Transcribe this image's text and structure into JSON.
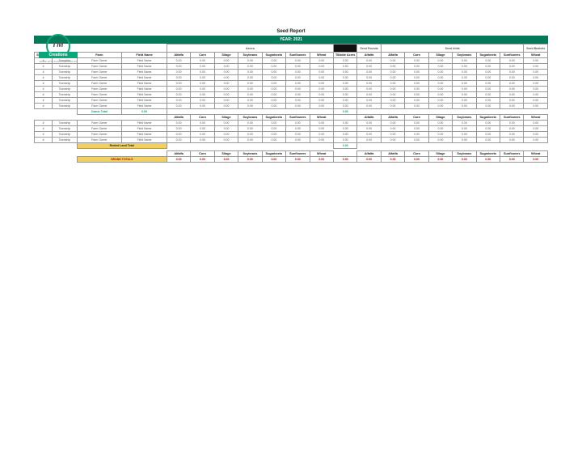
{
  "logo": {
    "initials": "TM",
    "banner": "Creations",
    "sub": "WORK WITH PURPOSE & TRUST"
  },
  "report_title": "Seed Report",
  "year_label": "YEAR: 2021",
  "group_headers": {
    "acres": "Acres",
    "seed_pounds": "Seed Pounds",
    "seed_units": "Seed Units",
    "seed_bushels": "Seed Bushels"
  },
  "columns": {
    "section": "Section #",
    "township": "Township",
    "farm": "Farm",
    "field": "Field Name",
    "crops": [
      "Alfalfa",
      "Corn",
      "Silage",
      "Soybeans",
      "Sugarbeets",
      "Sunflowers",
      "Wheat"
    ],
    "tillable": "Tillable Acres",
    "su_crops": [
      "Alfalfa",
      "Corn",
      "Silage",
      "Soybeans",
      "Sugarbeets",
      "Sunflowers"
    ],
    "wheat": "Wheat"
  },
  "section1_rows": [
    {
      "sec": "#",
      "twp": "Township",
      "farm": "Farm Owner",
      "field": "Field Name",
      "acres": [
        "0.00",
        "0.00",
        "0.00",
        "0.00",
        "0.00",
        "0.00",
        "0.00"
      ],
      "tillable": "0.00",
      "pounds": "0.00",
      "units": [
        "0.00",
        "0.00",
        "0.00",
        "0.00",
        "0.00",
        "0.00"
      ],
      "bushels": "0.00"
    },
    {
      "sec": "#",
      "twp": "Township",
      "farm": "Farm Owner",
      "field": "Field Name",
      "acres": [
        "0.00",
        "0.00",
        "0.00",
        "0.00",
        "0.00",
        "0.00",
        "0.00"
      ],
      "tillable": "0.00",
      "pounds": "0.00",
      "units": [
        "0.00",
        "0.00",
        "0.00",
        "0.00",
        "0.00",
        "0.00"
      ],
      "bushels": "0.00"
    },
    {
      "sec": "#",
      "twp": "Township",
      "farm": "Farm Owner",
      "field": "Field Name",
      "acres": [
        "0.00",
        "0.00",
        "0.00",
        "0.00",
        "0.00",
        "0.00",
        "0.00"
      ],
      "tillable": "0.00",
      "pounds": "0.00",
      "units": [
        "0.00",
        "0.00",
        "0.00",
        "0.00",
        "0.00",
        "0.00"
      ],
      "bushels": "0.00"
    },
    {
      "sec": "#",
      "twp": "Township",
      "farm": "Farm Owner",
      "field": "Field Name",
      "acres": [
        "0.00",
        "0.00",
        "0.00",
        "0.00",
        "0.00",
        "0.00",
        "0.00"
      ],
      "tillable": "0.00",
      "pounds": "0.00",
      "units": [
        "0.00",
        "0.00",
        "0.00",
        "0.00",
        "0.00",
        "0.00"
      ],
      "bushels": "0.00"
    },
    {
      "sec": "#",
      "twp": "Township",
      "farm": "Farm Owner",
      "field": "Field Name",
      "acres": [
        "0.00",
        "0.00",
        "0.00",
        "0.00",
        "0.00",
        "0.00",
        "0.00"
      ],
      "tillable": "0.00",
      "pounds": "0.00",
      "units": [
        "0.00",
        "0.00",
        "0.00",
        "0.00",
        "0.00",
        "0.00"
      ],
      "bushels": "0.00"
    },
    {
      "sec": "#",
      "twp": "Township",
      "farm": "Farm Owner",
      "field": "Field Name",
      "acres": [
        "0.00",
        "0.00",
        "0.00",
        "0.00",
        "0.00",
        "0.00",
        "0.00"
      ],
      "tillable": "0.00",
      "pounds": "0.00",
      "units": [
        "0.00",
        "0.00",
        "0.00",
        "0.00",
        "0.00",
        "0.00"
      ],
      "bushels": "0.00"
    },
    {
      "sec": "#",
      "twp": "Township",
      "farm": "Farm Owner",
      "field": "Field Name",
      "acres": [
        "0.00",
        "0.00",
        "0.00",
        "0.00",
        "0.00",
        "0.00",
        "0.00"
      ],
      "tillable": "0.00",
      "pounds": "0.00",
      "units": [
        "0.00",
        "0.00",
        "0.00",
        "0.00",
        "0.00",
        "0.00"
      ],
      "bushels": "0.00"
    },
    {
      "sec": "#",
      "twp": "Township",
      "farm": "Farm Owner",
      "field": "Field Name",
      "acres": [
        "0.00",
        "0.00",
        "0.00",
        "0.00",
        "0.00",
        "0.00",
        "0.00"
      ],
      "tillable": "0.00",
      "pounds": "0.00",
      "units": [
        "0.00",
        "0.00",
        "0.00",
        "0.00",
        "0.00",
        "0.00"
      ],
      "bushels": "0.00"
    },
    {
      "sec": "#",
      "twp": "Township",
      "farm": "Farm Owner",
      "field": "Field Name",
      "acres": [
        "0.00",
        "0.00",
        "0.00",
        "0.00",
        "0.00",
        "0.00",
        "0.00"
      ],
      "tillable": "0.00",
      "pounds": "0.00",
      "units": [
        "0.00",
        "0.00",
        "0.00",
        "0.00",
        "0.00",
        "0.00"
      ],
      "bushels": "0.00"
    }
  ],
  "owner_total_label": "Owner Total",
  "owner_total_values": [
    "0.00",
    "0.00"
  ],
  "section2_rows": [
    {
      "sec": "#",
      "twp": "Township",
      "farm": "Farm Owner",
      "field": "Field Name",
      "acres": [
        "0.00",
        "0.00",
        "0.00",
        "0.00",
        "0.00",
        "0.00",
        "0.00"
      ],
      "tillable": "0.00",
      "pounds": "0.00",
      "units": [
        "0.00",
        "0.00",
        "0.00",
        "0.00",
        "0.00",
        "0.00"
      ],
      "bushels": "0.00"
    },
    {
      "sec": "#",
      "twp": "Township",
      "farm": "Farm Owner",
      "field": "Field Name",
      "acres": [
        "0.00",
        "0.00",
        "0.00",
        "0.00",
        "0.00",
        "0.00",
        "0.00"
      ],
      "tillable": "0.00",
      "pounds": "0.00",
      "units": [
        "0.00",
        "0.00",
        "0.00",
        "0.00",
        "0.00",
        "0.00"
      ],
      "bushels": "0.00"
    },
    {
      "sec": "#",
      "twp": "Township",
      "farm": "Farm Owner",
      "field": "Field Name",
      "acres": [
        "0.00",
        "0.00",
        "0.00",
        "0.00",
        "0.00",
        "0.00",
        "0.00"
      ],
      "tillable": "0.00",
      "pounds": "0.00",
      "units": [
        "0.00",
        "0.00",
        "0.00",
        "0.00",
        "0.00",
        "0.00"
      ],
      "bushels": "0.00"
    },
    {
      "sec": "#",
      "twp": "Township",
      "farm": "Farm Owner",
      "field": "Field Name",
      "acres": [
        "0.00",
        "0.00",
        "0.00",
        "0.00",
        "0.00",
        "0.00",
        "0.00"
      ],
      "tillable": "0.00",
      "pounds": "0.00",
      "units": [
        "0.00",
        "0.00",
        "0.00",
        "0.00",
        "0.00",
        "0.00"
      ],
      "bushels": "0.00"
    }
  ],
  "rented_total_label": "Rented Land Total",
  "rented_total_value": "0.00",
  "grand_totals_label": "GRAND TOTALS",
  "grand_values": [
    "0.00",
    "0.00",
    "0.00",
    "0.00",
    "0.00",
    "0.00",
    "0.00",
    "0.00",
    "0.00",
    "0.00",
    "0.00",
    "0.00",
    "0.00",
    "0.00",
    "0.00",
    "0.00"
  ]
}
